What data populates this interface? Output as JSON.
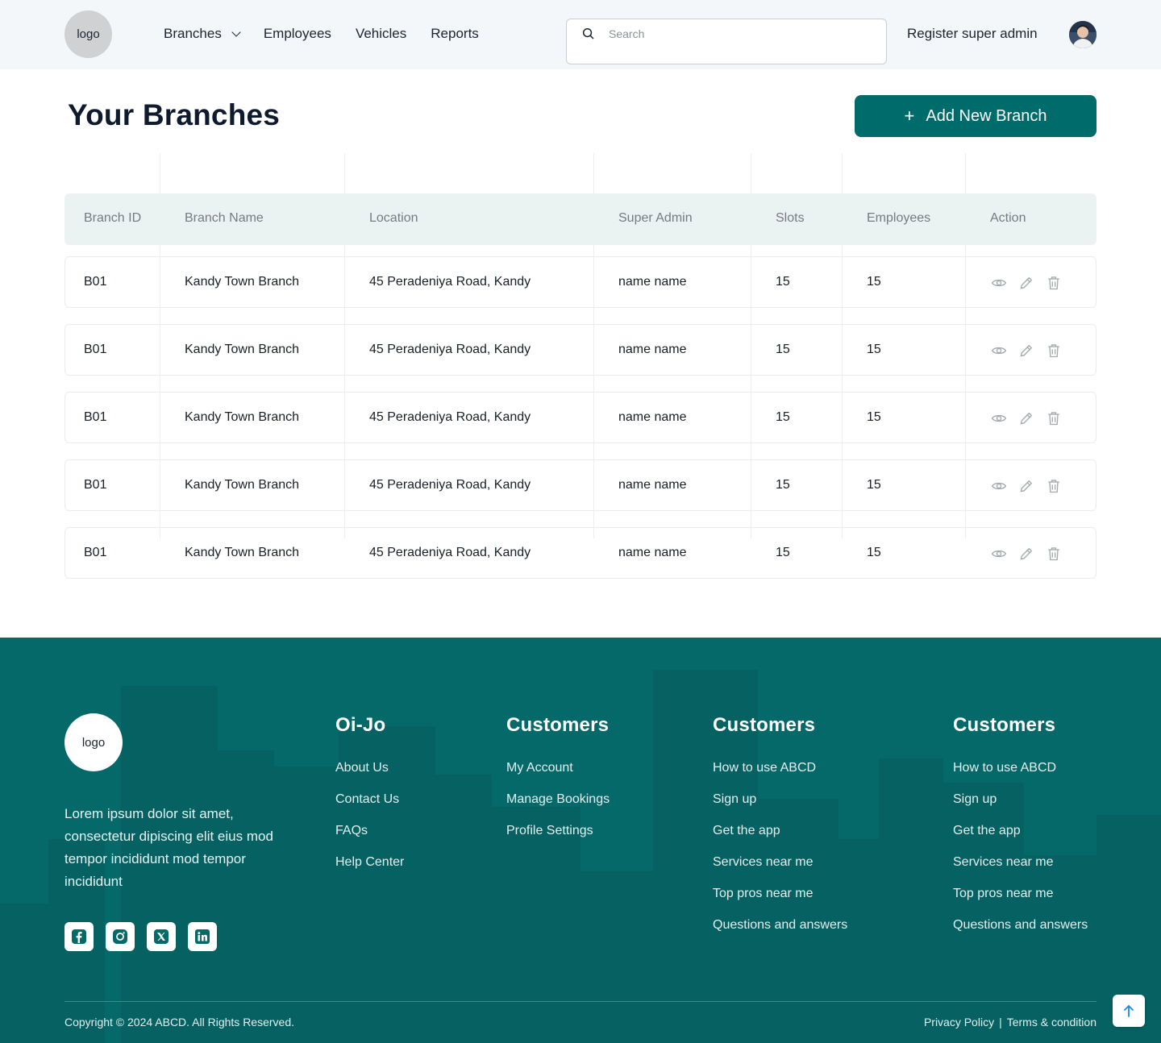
{
  "header": {
    "logo": "logo",
    "nav": [
      {
        "label": "Branches",
        "dropdown": true
      },
      {
        "label": "Employees"
      },
      {
        "label": "Vehicles"
      },
      {
        "label": "Reports"
      }
    ],
    "search_placeholder": "Search",
    "register_label": "Register super admin"
  },
  "page": {
    "title": "Your Branches",
    "add_button": "Add New Branch"
  },
  "table": {
    "columns": [
      "Branch ID",
      "Branch Name",
      "Location",
      "Super Admin",
      "Slots",
      "Employees",
      "Action"
    ],
    "rows": [
      {
        "id": "B01",
        "name": "Kandy Town Branch",
        "location": "45 Peradeniya Road, Kandy",
        "admin": "name name",
        "slots": "15",
        "employees": "15"
      },
      {
        "id": "B01",
        "name": "Kandy Town Branch",
        "location": "45 Peradeniya Road, Kandy",
        "admin": "name name",
        "slots": "15",
        "employees": "15"
      },
      {
        "id": "B01",
        "name": "Kandy Town Branch",
        "location": "45 Peradeniya Road, Kandy",
        "admin": "name name",
        "slots": "15",
        "employees": "15"
      },
      {
        "id": "B01",
        "name": "Kandy Town Branch",
        "location": "45 Peradeniya Road, Kandy",
        "admin": "name name",
        "slots": "15",
        "employees": "15"
      },
      {
        "id": "B01",
        "name": "Kandy Town Branch",
        "location": "45 Peradeniya Road, Kandy",
        "admin": "name name",
        "slots": "15",
        "employees": "15"
      }
    ],
    "action_icons": [
      "eye-icon",
      "pencil-icon",
      "trash-icon"
    ]
  },
  "footer": {
    "logo": "logo",
    "description": "Lorem ipsum dolor sit amet, consectetur dipiscing elit eius mod tempor incididunt mod tempor incididunt",
    "socials": [
      "facebook-icon",
      "instagram-icon",
      "x-icon",
      "linkedin-icon"
    ],
    "columns": [
      {
        "title": "Oi-Jo",
        "links": [
          "About Us",
          "Contact Us",
          "FAQs",
          "Help Center"
        ]
      },
      {
        "title": "Customers",
        "links": [
          "My Account",
          "Manage Bookings",
          "Profile Settings"
        ]
      },
      {
        "title": "Customers",
        "links": [
          "How to use ABCD",
          "Sign up",
          "Get the app",
          "Services near me",
          "Top pros near me",
          "Questions and answers"
        ]
      },
      {
        "title": "Customers",
        "links": [
          "How to use ABCD",
          "Sign up",
          "Get the app",
          "Services near me",
          "Top pros near me",
          "Questions and answers"
        ]
      }
    ],
    "copyright": "Copyright © 2024 ABCD. All Rights Reserved.",
    "privacy": "Privacy Policy",
    "separator": "|",
    "terms": "Terms & condition"
  },
  "colors": {
    "primary": "#006b6b",
    "footer_bg": "#05696a",
    "header_bg": "#f3f7fa",
    "table_head_bg": "#eaf3f2"
  }
}
